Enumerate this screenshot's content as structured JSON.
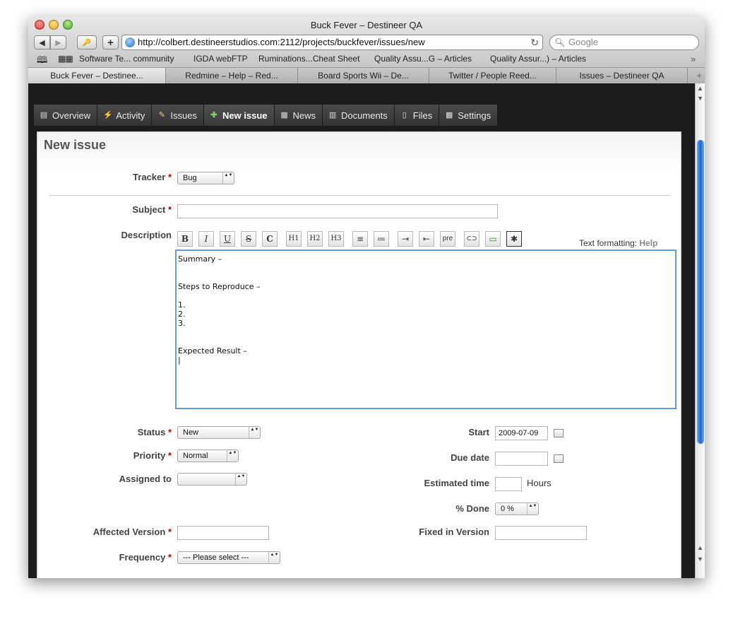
{
  "window": {
    "title": "Buck Fever – Destineer QA"
  },
  "toolbar": {
    "back": "◀",
    "forward": "▶",
    "key": "🔑",
    "add": "+",
    "url": "http://colbert.destineerstudios.com:2112/projects/buckfever/issues/new",
    "reload": "↻",
    "search_placeholder": "Google"
  },
  "bookmarks": [
    "Software Te... community",
    "IGDA webFTP",
    "Ruminations...Cheat Sheet",
    "Quality Assu...G – Articles",
    "Quality Assur...) – Articles"
  ],
  "bookmarks_more": "»",
  "browser_tabs": [
    "Buck Fever – Destinee...",
    "Redmine – Help – Red...",
    "Board Sports Wii – De...",
    "Twitter / People Reed...",
    "Issues – Destineer QA"
  ],
  "browser_tab_add": "+",
  "project_nav": [
    {
      "label": "Overview",
      "icon": "page-icon",
      "glyph": "▤"
    },
    {
      "label": "Activity",
      "icon": "lightning-icon",
      "glyph": "⚡"
    },
    {
      "label": "Issues",
      "icon": "ticket-icon",
      "glyph": "✎"
    },
    {
      "label": "New issue",
      "icon": "new-ticket-icon",
      "glyph": "✚"
    },
    {
      "label": "News",
      "icon": "news-icon",
      "glyph": "▦"
    },
    {
      "label": "Documents",
      "icon": "documents-icon",
      "glyph": "▥"
    },
    {
      "label": "Files",
      "icon": "files-icon",
      "glyph": "▯"
    },
    {
      "label": "Settings",
      "icon": "settings-icon",
      "glyph": "▩"
    }
  ],
  "form": {
    "heading": "New issue",
    "tracker": {
      "label": "Tracker",
      "value": "Bug"
    },
    "subject": {
      "label": "Subject",
      "value": ""
    },
    "description": {
      "label": "Description",
      "text": "Summary –\n\n\nSteps to Reproduce –\n\n1.\n2.\n3.\n\n\nExpected Result –\n|",
      "toolbar": [
        "B",
        "I",
        "U",
        "S",
        "C",
        "H1",
        "H2",
        "H3",
        "≡",
        "≔",
        "⇥",
        "⇤",
        "pre",
        "⊂⊃",
        "▭",
        "✱"
      ],
      "formatting_label": "Text formatting:",
      "formatting_help": "Help"
    },
    "status": {
      "label": "Status",
      "value": "New"
    },
    "priority": {
      "label": "Priority",
      "value": "Normal"
    },
    "assigned_to": {
      "label": "Assigned to",
      "value": ""
    },
    "affected_version": {
      "label": "Affected Version",
      "value": ""
    },
    "frequency": {
      "label": "Frequency",
      "value": "--- Please select ---"
    },
    "start": {
      "label": "Start",
      "value": "2009-07-09"
    },
    "due_date": {
      "label": "Due date",
      "value": ""
    },
    "estimated_time": {
      "label": "Estimated time",
      "value": "",
      "unit": "Hours"
    },
    "done": {
      "label": "% Done",
      "value": "0 %"
    },
    "fixed_in_version": {
      "label": "Fixed in Version",
      "value": ""
    },
    "required_mark": "*"
  },
  "scrollbar": {
    "up": "▲",
    "down": "▼"
  }
}
